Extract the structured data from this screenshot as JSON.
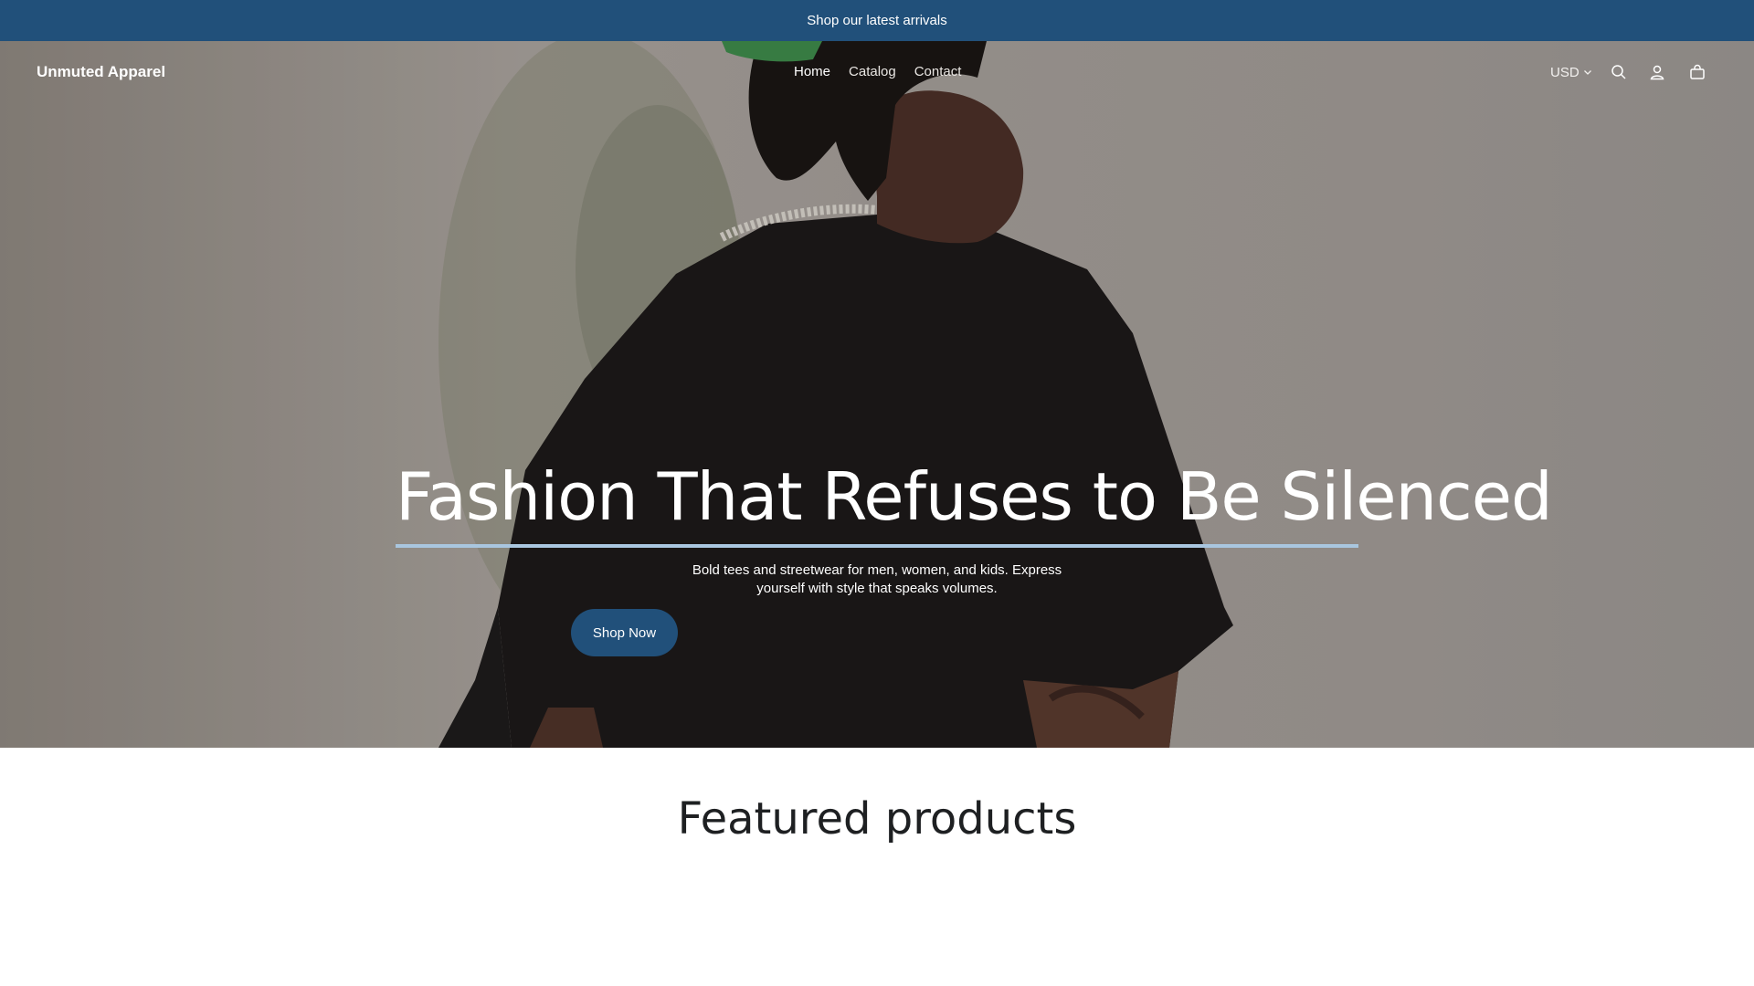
{
  "announcement": {
    "text": "Shop our latest arrivals"
  },
  "header": {
    "logo": "Unmuted Apparel",
    "nav": [
      {
        "label": "Home",
        "active": true
      },
      {
        "label": "Catalog",
        "active": false
      },
      {
        "label": "Contact",
        "active": false
      }
    ],
    "currency": "USD",
    "icons": [
      "search-icon",
      "account-icon",
      "cart-icon",
      "chevron-down-icon"
    ]
  },
  "hero": {
    "headline": "Fashion That Refuses to Be Silenced",
    "subtext": "Bold tees and streetwear for men, women, and kids. Express yourself with style that speaks volumes.",
    "cta": "Shop Now"
  },
  "featured": {
    "title": "Featured products"
  },
  "colors": {
    "brand": "#21507a",
    "accent_rule": "#a9c6df",
    "text_dark": "#1e2022"
  }
}
